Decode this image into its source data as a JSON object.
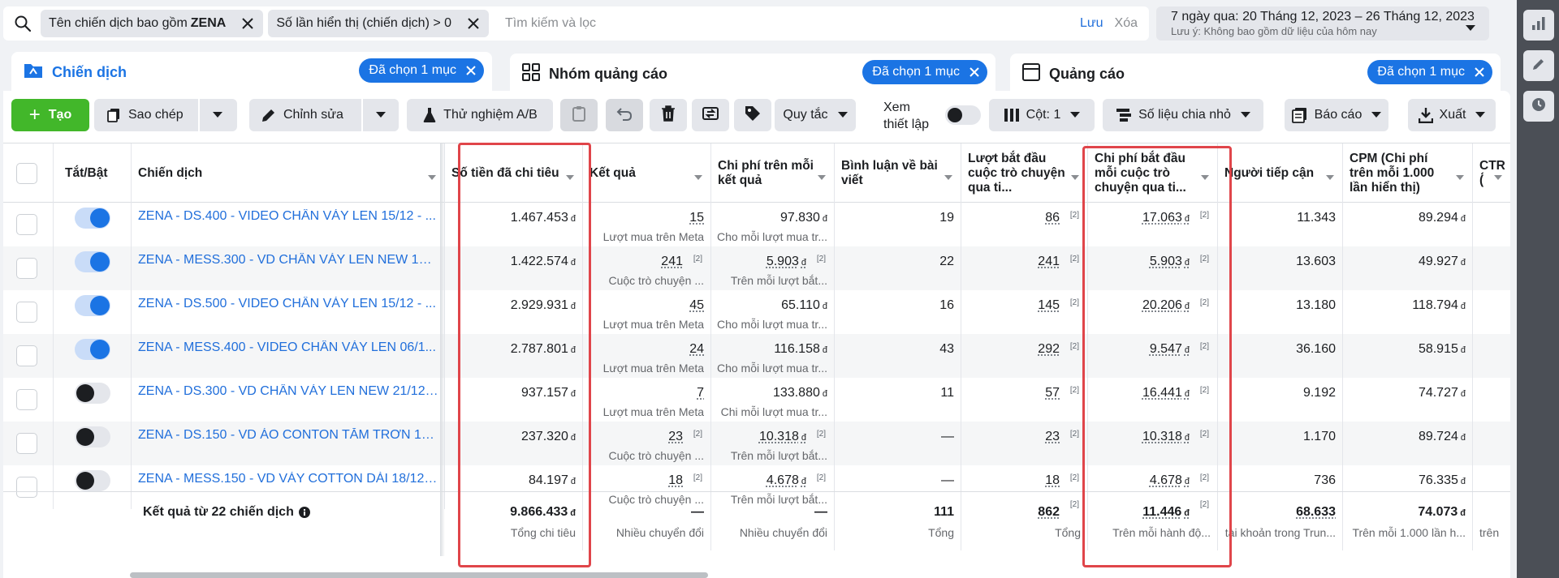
{
  "filter_bar": {
    "chips": [
      {
        "label": "Tên chiến dịch bao gồm",
        "bold": "ZENA"
      },
      {
        "label": "Số lần hiển thị (chiến dịch) > 0",
        "bold": ""
      }
    ],
    "search_placeholder": "Tìm kiếm và lọc",
    "save_label": "Lưu",
    "clear_label": "Xóa"
  },
  "date_range": {
    "label": "7 ngày qua: 20 Tháng 12, 2023 – 26 Tháng 12, 2023",
    "note": "Lưu ý: Không bao gồm dữ liệu của hôm nay"
  },
  "tabs": [
    {
      "label": "Chiến dịch",
      "pill": "Đã chọn 1 mục"
    },
    {
      "label": "Nhóm quảng cáo",
      "pill": "Đã chọn 1 mục"
    },
    {
      "label": "Quảng cáo",
      "pill": "Đã chọn 1 mục"
    }
  ],
  "toolbar": {
    "create": "Tạo",
    "duplicate": "Sao chép",
    "edit": "Chỉnh sửa",
    "ab_test": "Thử nghiệm A/B",
    "rules": "Quy tắc",
    "view_setup_1": "Xem",
    "view_setup_2": "thiết lập",
    "columns": "Cột: 1",
    "breakdown": "Số liệu chia nhỏ",
    "reports": "Báo cáo",
    "export": "Xuất"
  },
  "columns": [
    "Tắt/Bật",
    "Chiến dịch",
    "Số tiền đã chi tiêu",
    "Kết quả",
    "Chi phí trên mỗi kết quả",
    "Bình luận về bài viết",
    "Lượt bắt đầu cuộc trò chuyện qua ti...",
    "Chi phí bắt đầu mỗi cuộc trò chuyện qua ti...",
    "Người tiếp cận",
    "CPM (Chi phí trên mỗi 1.000 lần hiển thị)",
    "CTR (́"
  ],
  "currency": "đ",
  "sup_mark": "[2]",
  "rows": [
    {
      "on": true,
      "name": "ZENA - DS.400 - VIDEO CHÂN VÁY LEN 15/12 - ...",
      "spend": "1.467.453",
      "result": "15",
      "result_sup": false,
      "result_sub": "Lượt mua trên Meta",
      "cpr": "97.830",
      "cpr_u": false,
      "cpr_sup": false,
      "cpr_sub": "Cho mỗi lượt mua tr...",
      "comments": "19",
      "convos": "86",
      "cost_convo": "17.063",
      "reach": "11.343",
      "cpm": "89.294"
    },
    {
      "on": true,
      "name": "ZENA - MESS.300 - VD CHÂN VÁY LEN NEW 18/...",
      "spend": "1.422.574",
      "result": "241",
      "result_sup": true,
      "result_sub": "Cuộc trò chuyện ...",
      "cpr": "5.903",
      "cpr_u": true,
      "cpr_sup": true,
      "cpr_sub": "Trên mỗi lượt bắt...",
      "comments": "22",
      "convos": "241",
      "cost_convo": "5.903",
      "reach": "13.603",
      "cpm": "49.927"
    },
    {
      "on": true,
      "name": "ZENA - DS.500 - VIDEO CHÂN VÁY LEN 15/12 - ...",
      "spend": "2.929.931",
      "result": "45",
      "result_sup": false,
      "result_sub": "Lượt mua trên Meta",
      "cpr": "65.110",
      "cpr_u": false,
      "cpr_sup": false,
      "cpr_sub": "Cho mỗi lượt mua tr...",
      "comments": "16",
      "convos": "145",
      "cost_convo": "20.206",
      "reach": "13.180",
      "cpm": "118.794"
    },
    {
      "on": true,
      "name": "ZENA - MESS.400 - VIDEO CHÂN VÁY LEN 06/1...",
      "spend": "2.787.801",
      "result": "24",
      "result_sup": false,
      "result_sub": "Lượt mua trên Meta",
      "cpr": "116.158",
      "cpr_u": false,
      "cpr_sup": false,
      "cpr_sub": "Cho mỗi lượt mua tr...",
      "comments": "43",
      "convos": "292",
      "cost_convo": "9.547",
      "reach": "36.160",
      "cpm": "58.915"
    },
    {
      "on": false,
      "name": "ZENA - DS.300 - VD CHÂN VÁY LEN NEW 21/12 ...",
      "spend": "937.157",
      "result": "7",
      "result_sup": false,
      "result_sub": "Lượt mua trên Meta",
      "cpr": "133.880",
      "cpr_u": false,
      "cpr_sup": false,
      "cpr_sub": "Chi mỗi lượt mua tr...",
      "comments": "11",
      "convos": "57",
      "cost_convo": "16.441",
      "reach": "9.192",
      "cpm": "74.727"
    },
    {
      "on": false,
      "name": "ZENA - DS.150 - VD ÁO CONTON TĂM TRƠN 18...",
      "spend": "237.320",
      "result": "23",
      "result_sup": true,
      "result_sub": "Cuộc trò chuyện ...",
      "cpr": "10.318",
      "cpr_u": true,
      "cpr_sup": true,
      "cpr_sub": "Trên mỗi lượt bắt...",
      "comments": "—",
      "convos": "23",
      "cost_convo": "10.318",
      "reach": "1.170",
      "cpm": "89.724"
    },
    {
      "on": false,
      "name": "ZENA - MESS.150 - VD VÁY COTTON DÀI 18/12 ...",
      "spend": "84.197",
      "result": "18",
      "result_sup": true,
      "result_sub": "Cuộc trò chuyện ...",
      "cpr": "4.678",
      "cpr_u": true,
      "cpr_sup": true,
      "cpr_sub": "Trên mỗi lượt bắt...",
      "comments": "—",
      "convos": "18",
      "cost_convo": "4.678",
      "reach": "736",
      "cpm": "76.335"
    }
  ],
  "totals": {
    "label": "Kết quả từ 22 chiến dịch",
    "spend": "9.866.433",
    "spend_sub": "Tổng chi tiêu",
    "result": "—",
    "result_sub": "Nhiều chuyển đổi",
    "cpr": "—",
    "cpr_sub": "Nhiều chuyển đổi",
    "comments": "111",
    "comments_sub": "Tổng",
    "convos": "862",
    "convos_sub": "Tổng",
    "cost_convo": "11.446",
    "cost_convo_sub": "Trên mỗi hành độ...",
    "reach": "68.633",
    "reach_sub": "tài khoản trong Trun...",
    "cpm": "74.073",
    "cpm_sub": "Trên mỗi 1.000 lần h...",
    "ctr_sub": "trên"
  }
}
